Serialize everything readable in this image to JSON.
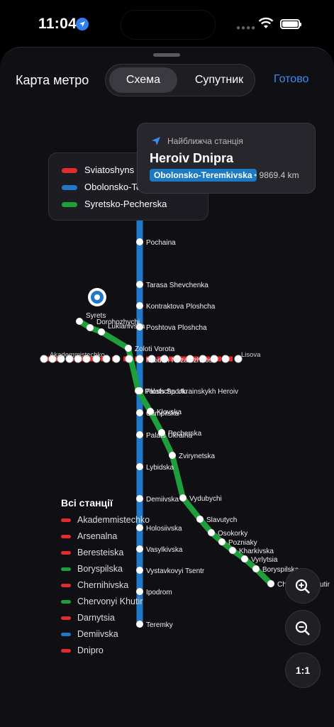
{
  "status_bar": {
    "time": "11:04"
  },
  "header": {
    "title": "Карта метро",
    "segments": [
      "Схема",
      "Супутник"
    ],
    "active_segment": 0,
    "done_label": "Готово"
  },
  "lines": [
    {
      "name": "Sviatoshynsko-Brovarska",
      "color": "#e42b2b"
    },
    {
      "name": "Obolonsko-Teremkivska",
      "color": "#1f78c8"
    },
    {
      "name": "Syretsko-Pecherska",
      "color": "#1f9e3c"
    }
  ],
  "legend_visible": [
    "Sviatoshyns",
    "Obolonsko-Teremkivska",
    "Syretsko-Pecherska"
  ],
  "nearest": {
    "heading": "Найближча станція",
    "name": "Heroiv Dnipra",
    "line": "Obolonsko-Teremkivska",
    "distance": "• 9869.4 km"
  },
  "map": {
    "blue_stations": [
      {
        "name": "Pochaina"
      },
      {
        "name": "Tarasa Shevchenka"
      },
      {
        "name": "Kontraktova Ploshcha"
      },
      {
        "name": "Poshtova Ploshcha"
      },
      {
        "name": "Maidan Nezalezhnosti"
      },
      {
        "name": "Ploshcha Ukrainskykh Heroiv"
      },
      {
        "name": "Olimpiiska"
      },
      {
        "name": "Palats Ukraina"
      },
      {
        "name": "Lybidska"
      },
      {
        "name": "Demiivska"
      },
      {
        "name": "Holosiivska"
      },
      {
        "name": "Vasylkivska"
      },
      {
        "name": "Vystavkovyi Tsentr"
      },
      {
        "name": "Ipodrom"
      },
      {
        "name": "Teremky"
      }
    ],
    "green_stations": [
      {
        "name": "Syrets"
      },
      {
        "name": "Dorohozhychi"
      },
      {
        "name": "Lukianivska"
      },
      {
        "name": "Zoloti Vorota"
      },
      {
        "name": "Palats Sportu"
      },
      {
        "name": "Klovska"
      },
      {
        "name": "Pecherska"
      },
      {
        "name": "Zvirynetska"
      },
      {
        "name": "Vydubychi"
      },
      {
        "name": "Slavutych"
      },
      {
        "name": "Osokorky"
      },
      {
        "name": "Pozniaky"
      },
      {
        "name": "Kharkivska"
      },
      {
        "name": "Vyrlytsia"
      },
      {
        "name": "Boryspilska"
      },
      {
        "name": "Chervonyi Khutir"
      }
    ],
    "red_label_left": "Akademmistechko",
    "red_label_right": "Lisova",
    "red_label_right_shown": "Chernihivska"
  },
  "all_stations": {
    "title": "Всі станції",
    "items": [
      {
        "name": "Akademmistechko",
        "line": 0
      },
      {
        "name": "Arsenalna",
        "line": 0
      },
      {
        "name": "Beresteiska",
        "line": 0
      },
      {
        "name": "Boryspilska",
        "line": 2
      },
      {
        "name": "Chernihivska",
        "line": 0
      },
      {
        "name": "Chervonyi Khutir",
        "line": 2
      },
      {
        "name": "Darnytsia",
        "line": 0
      },
      {
        "name": "Demiivska",
        "line": 1
      },
      {
        "name": "Dnipro",
        "line": 0
      }
    ]
  },
  "zoom": {
    "reset_label": "1:1"
  }
}
